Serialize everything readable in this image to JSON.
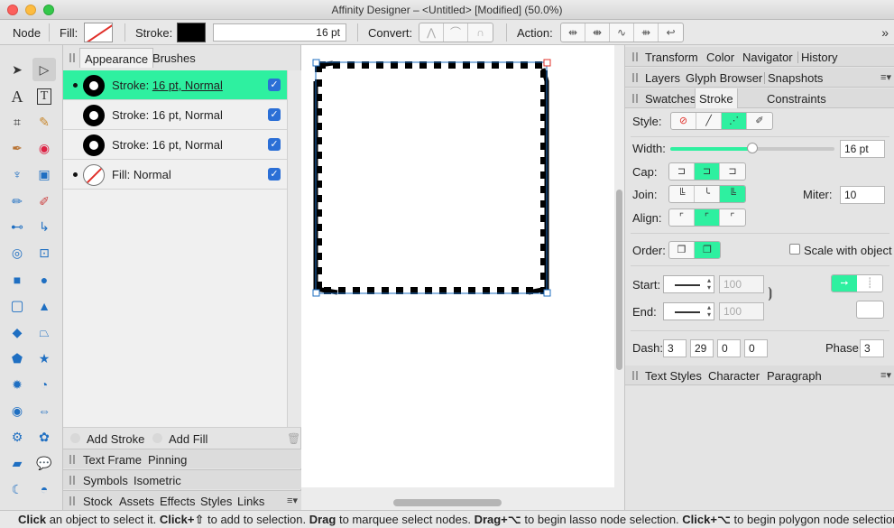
{
  "window": {
    "title": "Affinity Designer – <Untitled> [Modified] (50.0%)"
  },
  "context_toolbar": {
    "mode": "Node",
    "fill_label": "Fill:",
    "stroke_label": "Stroke:",
    "stroke_width": "16 pt",
    "convert_label": "Convert:",
    "action_label": "Action:",
    "more_icon": "chevrons-right-icon"
  },
  "left_panel": {
    "tabs": [
      "Appearance",
      "Brushes"
    ],
    "active_tab": "Appearance",
    "layers": [
      {
        "label": "Stroke: ",
        "value": "16 pt, Normal",
        "checked": true,
        "selected": true,
        "type": "stroke"
      },
      {
        "label": "Stroke: 16 pt, Normal",
        "checked": true,
        "selected": false,
        "type": "stroke"
      },
      {
        "label": "Stroke: 16 pt, Normal",
        "checked": true,
        "selected": false,
        "type": "stroke"
      },
      {
        "label": "Fill: Normal",
        "checked": true,
        "selected": false,
        "type": "fill"
      }
    ],
    "add_stroke": "Add Stroke",
    "add_fill": "Add Fill",
    "collapsed_rows": [
      [
        "Text Frame",
        "Pinning"
      ],
      [
        "Symbols",
        "Isometric"
      ],
      [
        "Stock",
        "Assets",
        "Effects",
        "Styles",
        "Links"
      ]
    ]
  },
  "right_panel": {
    "row1": [
      "Transform",
      "Color",
      "Navigator",
      "History"
    ],
    "row2": [
      "Layers",
      "Glyph Browser",
      "Snapshots"
    ],
    "row3": [
      "Swatches",
      "Stroke",
      "Constraints"
    ],
    "active_tab": "Stroke",
    "style_label": "Style:",
    "width_label": "Width:",
    "width_value": "16 pt",
    "width_fraction": 0.5,
    "cap_label": "Cap:",
    "join_label": "Join:",
    "miter_label": "Miter:",
    "miter_value": "10",
    "align_label": "Align:",
    "order_label": "Order:",
    "scale_label": "Scale with object",
    "start_label": "Start:",
    "end_label": "End:",
    "start_scale": "100",
    "end_scale": "100",
    "dash_label": "Dash:",
    "dash_values": [
      "3",
      "29",
      "0",
      "0"
    ],
    "phase_label": "Phase:",
    "phase_value": "3",
    "bottom_tabs": [
      "Text Styles",
      "Character",
      "Paragraph"
    ]
  },
  "status": {
    "parts": [
      {
        "b": "Click",
        "t": " an object to select it. "
      },
      {
        "b": "Click+⇧",
        "t": " to add to selection. "
      },
      {
        "b": "Drag",
        "t": " to marquee select nodes. "
      },
      {
        "b": "Drag+⌥",
        "t": " to begin lasso node selection. "
      },
      {
        "b": "Click+⌥",
        "t": " to begin polygon node selection."
      }
    ]
  },
  "colors": {
    "accent": "#2ef0a0",
    "checkbox": "#2b6fd6",
    "handle_red": "#e0302a",
    "handle_blue": "#1f6fc2"
  }
}
